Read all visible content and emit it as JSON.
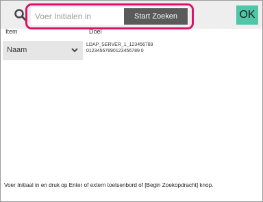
{
  "search": {
    "placeholder": "Voer Initialen in",
    "value": "",
    "start_label": "Start Zoeken"
  },
  "header": {
    "ok_label": "OK"
  },
  "columns": {
    "item": "Item",
    "doel": "Doel"
  },
  "item_select": {
    "selected": "Naam"
  },
  "doel": {
    "line1": "LDAP_SERVER_1_123456789",
    "line2": "01234567890123456789 0"
  },
  "hint": "Voer Initiaal in en druk op Enter of extern toetsenbord of [Begin Zoekopdracht] knop.",
  "colors": {
    "highlight": "#e0106a",
    "ok": "#4fc6a8",
    "start_button": "#5a5a5a"
  },
  "icons": [
    "search-icon",
    "chevron-down-icon"
  ]
}
